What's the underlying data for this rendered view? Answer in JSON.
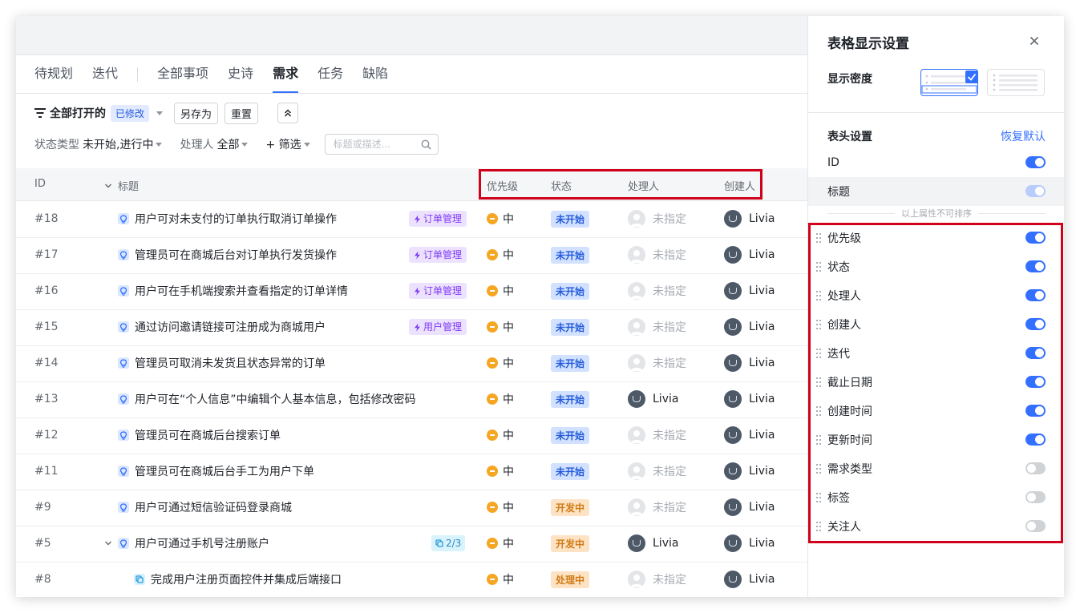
{
  "tabs": [
    "待规划",
    "迭代",
    "全部事项",
    "史诗",
    "需求",
    "任务",
    "缺陷"
  ],
  "active_tab": "需求",
  "filter": {
    "view_name": "全部打开的",
    "modified_badge": "已修改",
    "save_as": "另存为",
    "reset": "重置",
    "status_type_label": "状态类型",
    "status_type_value": "未开始,进行中",
    "assignee_label": "处理人",
    "assignee_value": "全部",
    "add_filter": "+ 筛选",
    "search_placeholder": "标题或描述..."
  },
  "columns": {
    "id": "ID",
    "title": "标题",
    "priority": "优先级",
    "status": "状态",
    "assignee": "处理人",
    "creator": "创建人"
  },
  "rows": [
    {
      "id": "#18",
      "title": "用户可对未支付的订单执行取消订单操作",
      "tag": "订单管理",
      "priority": "中",
      "status": "未开始",
      "status_color": "blue",
      "assignee": "未指定",
      "assigned": false,
      "creator": "Livia"
    },
    {
      "id": "#17",
      "title": "管理员可在商城后台对订单执行发货操作",
      "tag": "订单管理",
      "priority": "中",
      "status": "未开始",
      "status_color": "blue",
      "assignee": "未指定",
      "assigned": false,
      "creator": "Livia"
    },
    {
      "id": "#16",
      "title": "用户可在手机端搜索并查看指定的订单详情",
      "tag": "订单管理",
      "priority": "中",
      "status": "未开始",
      "status_color": "blue",
      "assignee": "未指定",
      "assigned": false,
      "creator": "Livia"
    },
    {
      "id": "#15",
      "title": "通过访问邀请链接可注册成为商城用户",
      "tag": "用户管理",
      "priority": "中",
      "status": "未开始",
      "status_color": "blue",
      "assignee": "未指定",
      "assigned": false,
      "creator": "Livia"
    },
    {
      "id": "#14",
      "title": "管理员可取消未发货且状态异常的订单",
      "tag": "",
      "priority": "中",
      "status": "未开始",
      "status_color": "blue",
      "assignee": "未指定",
      "assigned": false,
      "creator": "Livia"
    },
    {
      "id": "#13",
      "title": "用户可在“个人信息”中编辑个人基本信息，包括修改密码",
      "tag": "",
      "priority": "中",
      "status": "未开始",
      "status_color": "blue",
      "assignee": "Livia",
      "assigned": true,
      "creator": "Livia"
    },
    {
      "id": "#12",
      "title": "管理员可在商城后台搜索订单",
      "tag": "",
      "priority": "中",
      "status": "未开始",
      "status_color": "blue",
      "assignee": "未指定",
      "assigned": false,
      "creator": "Livia"
    },
    {
      "id": "#11",
      "title": "管理员可在商城后台手工为用户下单",
      "tag": "",
      "priority": "中",
      "status": "未开始",
      "status_color": "blue",
      "assignee": "未指定",
      "assigned": false,
      "creator": "Livia"
    },
    {
      "id": "#9",
      "title": "用户可通过短信验证码登录商城",
      "tag": "",
      "priority": "中",
      "status": "开发中",
      "status_color": "orange",
      "assignee": "未指定",
      "assigned": false,
      "creator": "Livia"
    },
    {
      "id": "#5",
      "title": "用户可通过手机号注册账户",
      "tag": "",
      "subtask": "2/3",
      "expandable": true,
      "priority": "中",
      "status": "开发中",
      "status_color": "orange",
      "assignee": "Livia",
      "assigned": true,
      "creator": "Livia"
    },
    {
      "id": "#8",
      "title": "完成用户注册页面控件并集成后端接口",
      "tag": "",
      "child": true,
      "priority": "中",
      "status": "处理中",
      "status_color": "orange",
      "assignee": "未指定",
      "assigned": false,
      "creator": "Livia"
    }
  ],
  "panel": {
    "title": "表格显示设置",
    "density_label": "显示密度",
    "header_label": "表头设置",
    "restore_default": "恢复默认",
    "sort_note": "以上属性不可排序",
    "fixed_fields": [
      {
        "label": "ID",
        "state": "on"
      },
      {
        "label": "标题",
        "state": "locked"
      }
    ],
    "fields": [
      {
        "label": "优先级",
        "state": "on"
      },
      {
        "label": "状态",
        "state": "on"
      },
      {
        "label": "处理人",
        "state": "on"
      },
      {
        "label": "创建人",
        "state": "on"
      },
      {
        "label": "迭代",
        "state": "on"
      },
      {
        "label": "截止日期",
        "state": "on"
      },
      {
        "label": "创建时间",
        "state": "on"
      },
      {
        "label": "更新时间",
        "state": "on"
      },
      {
        "label": "需求类型",
        "state": "off"
      },
      {
        "label": "标签",
        "state": "off"
      },
      {
        "label": "关注人",
        "state": "off"
      }
    ]
  },
  "colors": {
    "accent": "#3370ff",
    "highlight_border": "#d0021b",
    "priority_medium": "#f5a623"
  }
}
